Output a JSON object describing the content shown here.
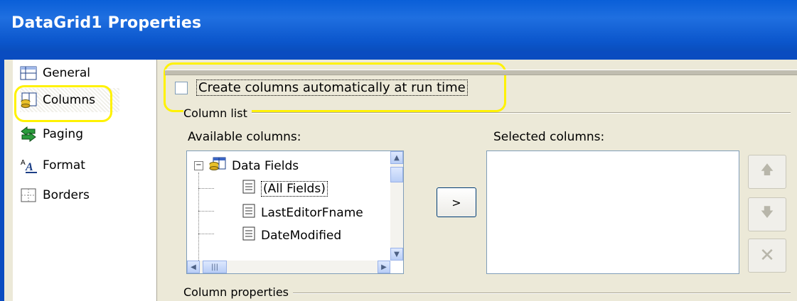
{
  "window": {
    "title": "DataGrid1 Properties"
  },
  "nav": {
    "items": [
      {
        "label": "General",
        "icon": "grid-icon"
      },
      {
        "label": "Columns",
        "icon": "columns-database-icon",
        "selected": true
      },
      {
        "label": "Paging",
        "icon": "paging-arrows-icon"
      },
      {
        "label": "Format",
        "icon": "format-font-icon"
      },
      {
        "label": "Borders",
        "icon": "borders-icon"
      }
    ]
  },
  "columns_page": {
    "auto_create_label": "Create columns automatically at run time",
    "auto_create_checked": false,
    "column_list_label": "Column list",
    "available_label": "Available columns:",
    "selected_label": "Selected columns:",
    "add_button_label": ">",
    "column_properties_label": "Column properties",
    "tree": {
      "root": "Data Fields",
      "children": [
        "(All Fields)",
        "LastEditorFname",
        "DateModified"
      ]
    }
  },
  "colors": {
    "highlight": "#FFF200",
    "titlebar": "#0A5FD8",
    "background": "#ECE9D8"
  }
}
